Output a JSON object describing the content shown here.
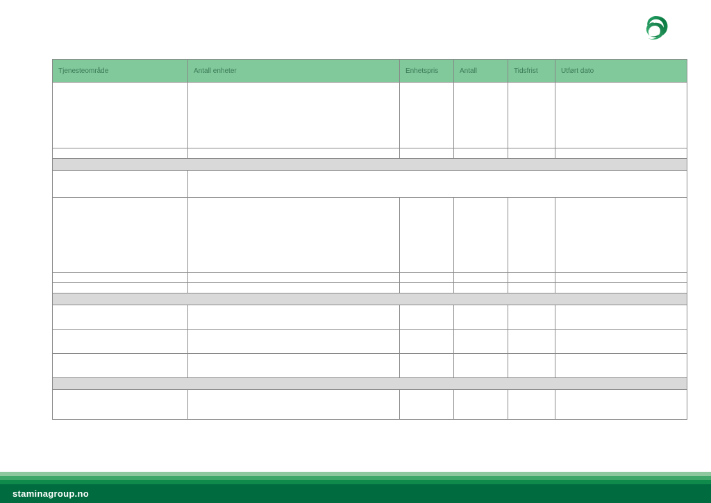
{
  "headers": {
    "col1": "Tjenesteområde",
    "col2": "Antall enheter",
    "col3": "Enhetspris",
    "col4": "Antall",
    "col5": "Tidsfrist",
    "col6": "Utført dato"
  },
  "footer": {
    "site": "staminagroup.no"
  }
}
